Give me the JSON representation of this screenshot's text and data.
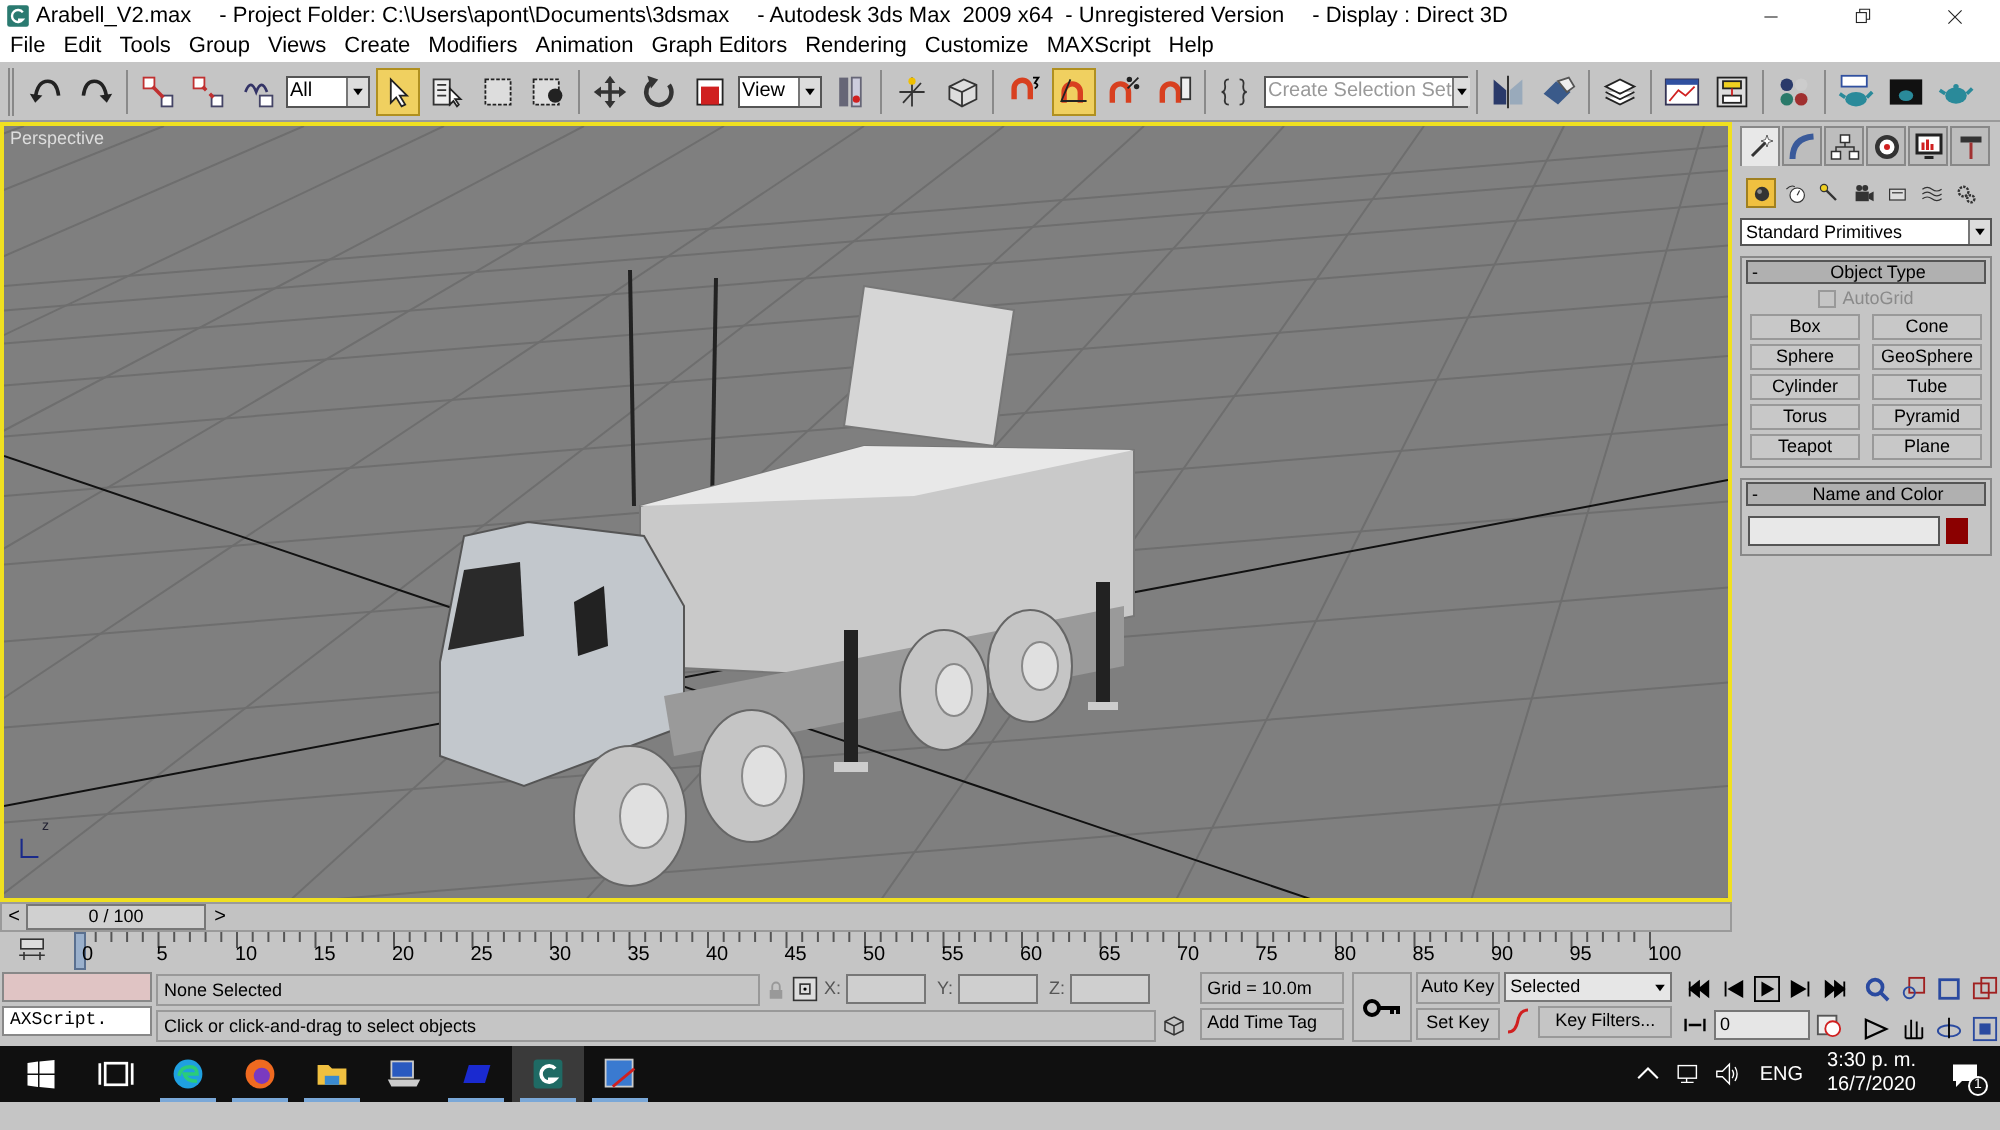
{
  "window": {
    "title_parts": [
      "Arabell_V2.max",
      "- Project Folder: C:\\Users\\apont\\Documents\\3dsmax",
      "- Autodesk 3ds Max  2009 x64  - Unregistered Version",
      "- Display : Direct 3D"
    ]
  },
  "menu": [
    "File",
    "Edit",
    "Tools",
    "Group",
    "Views",
    "Create",
    "Modifiers",
    "Animation",
    "Graph Editors",
    "Rendering",
    "Customize",
    "MAXScript",
    "Help"
  ],
  "toolbar": [
    {
      "kind": "undo",
      "selected": false
    },
    {
      "kind": "redo",
      "selected": false
    },
    {
      "kind": "sep"
    },
    {
      "kind": "link",
      "selected": false
    },
    {
      "kind": "unlink",
      "selected": false
    },
    {
      "kind": "bind",
      "selected": false
    },
    {
      "kind": "dropdown",
      "value": "All"
    },
    {
      "kind": "select",
      "selected": true
    },
    {
      "kind": "select-by-name",
      "selected": false
    },
    {
      "kind": "rect-region",
      "selected": false
    },
    {
      "kind": "window-crossing",
      "selected": false
    },
    {
      "kind": "sep"
    },
    {
      "kind": "move",
      "selected": false
    },
    {
      "kind": "rotate",
      "selected": false
    },
    {
      "kind": "scale",
      "selected": false
    },
    {
      "kind": "dropdown",
      "value": "View"
    },
    {
      "kind": "pivot",
      "selected": false
    },
    {
      "kind": "sep"
    },
    {
      "kind": "manipulate",
      "selected": false
    },
    {
      "kind": "keyboard",
      "selected": false
    },
    {
      "kind": "sep"
    },
    {
      "kind": "snap",
      "selected": false
    },
    {
      "kind": "angle-snap",
      "selected": true
    },
    {
      "kind": "percent-snap",
      "selected": false
    },
    {
      "kind": "spinner-snap",
      "selected": false
    },
    {
      "kind": "sep"
    },
    {
      "kind": "named-sets",
      "selected": false
    },
    {
      "kind": "combo",
      "placeholder": "Create Selection Set"
    },
    {
      "kind": "sep"
    },
    {
      "kind": "mirror",
      "selected": false
    },
    {
      "kind": "align",
      "selected": false
    },
    {
      "kind": "sep"
    },
    {
      "kind": "layers",
      "selected": false
    },
    {
      "kind": "sep"
    },
    {
      "kind": "curve-editor",
      "selected": false
    },
    {
      "kind": "schematic",
      "selected": false
    },
    {
      "kind": "sep"
    },
    {
      "kind": "material",
      "selected": false
    },
    {
      "kind": "sep"
    },
    {
      "kind": "render-setup",
      "selected": false
    },
    {
      "kind": "render-frame",
      "selected": false
    },
    {
      "kind": "quick-render",
      "selected": false
    }
  ],
  "viewport": {
    "label": "Perspective",
    "axis_label": "z"
  },
  "command_panel": {
    "tabs": [
      {
        "kind": "create",
        "selected": true
      },
      {
        "kind": "modify",
        "selected": false
      },
      {
        "kind": "hierarchy",
        "selected": false
      },
      {
        "kind": "motion",
        "selected": false
      },
      {
        "kind": "display",
        "selected": false
      },
      {
        "kind": "utilities",
        "selected": false
      }
    ],
    "categories": [
      {
        "kind": "geometry",
        "selected": true
      },
      {
        "kind": "shapes",
        "selected": false
      },
      {
        "kind": "lights",
        "selected": false
      },
      {
        "kind": "cameras",
        "selected": false
      },
      {
        "kind": "helpers",
        "selected": false
      },
      {
        "kind": "spacewarps",
        "selected": false
      },
      {
        "kind": "systems",
        "selected": false
      }
    ],
    "dropdown": "Standard Primitives",
    "object_type": {
      "toggle": "-",
      "title": "Object Type",
      "autogrid": {
        "label": "AutoGrid",
        "checked": false,
        "disabled": true
      },
      "buttons": [
        "Box",
        "Cone",
        "Sphere",
        "GeoSphere",
        "Cylinder",
        "Tube",
        "Torus",
        "Pyramid",
        "Teapot",
        "Plane"
      ]
    },
    "name_and_color": {
      "toggle": "-",
      "title": "Name and Color",
      "color": "#8b0000"
    }
  },
  "timeline": {
    "prev": "<",
    "slider": "0 / 100",
    "next": ">",
    "ticks": [
      "0",
      "5",
      "10",
      "15",
      "20",
      "25",
      "30",
      "35",
      "40",
      "45",
      "50",
      "55",
      "60",
      "65",
      "70",
      "75",
      "80",
      "85",
      "90",
      "95",
      "100"
    ]
  },
  "status": {
    "listener": "AXScript.",
    "selection": "None Selected",
    "prompt": "Click or click-and-drag to select objects",
    "x_label": "X:",
    "y_label": "Y:",
    "z_label": "Z:",
    "grid": "Grid = 10.0m",
    "time_tag": "Add Time Tag",
    "auto_key": "Auto Key",
    "set_key": "Set Key",
    "key_mode": "Selected",
    "key_filters": "Key Filters...",
    "frame": "0"
  },
  "taskbar": {
    "apps": [
      {
        "kind": "task-view",
        "active": false
      },
      {
        "kind": "edge",
        "active": true
      },
      {
        "kind": "firefox",
        "active": true
      },
      {
        "kind": "explorer",
        "active": true
      },
      {
        "kind": "computer",
        "active": false
      },
      {
        "kind": "blue-app",
        "active": true
      },
      {
        "kind": "max",
        "active": true
      },
      {
        "kind": "paint",
        "active": true
      }
    ],
    "language": "ENG",
    "time": "3:30 p. m.",
    "date": "16/7/2020",
    "notifications": "1"
  }
}
